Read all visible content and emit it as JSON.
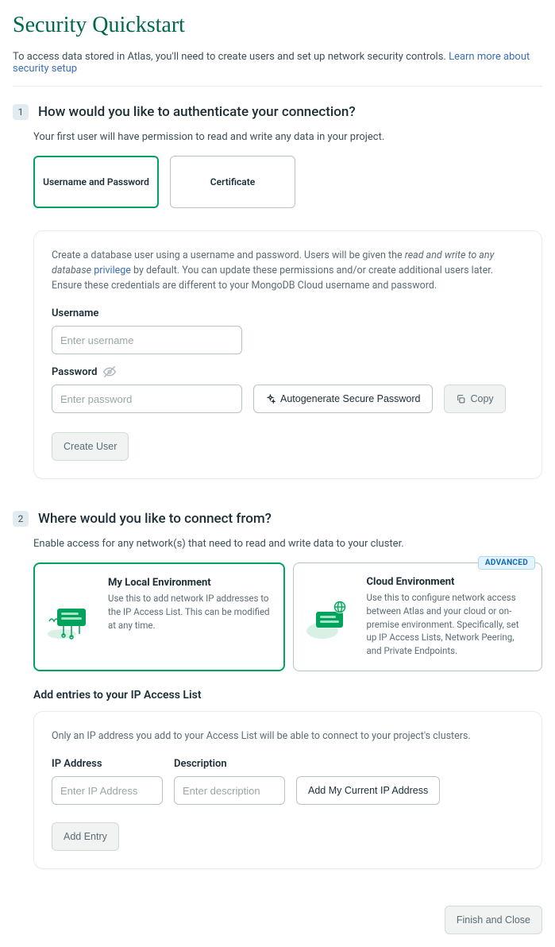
{
  "title": "Security Quickstart",
  "intro": {
    "text": "To access data stored in Atlas, you'll need to create users and set up network security controls. ",
    "link": "Learn more about security setup"
  },
  "section1": {
    "step": "1",
    "title": "How would you like to authenticate your connection?",
    "sub": "Your first user will have permission to read and write any data in your project.",
    "options": {
      "userpass": "Username and Password",
      "cert": "Certificate"
    },
    "card": {
      "text_pre": "Create a database user using a username and password. Users will be given the ",
      "text_italic": "read and write to any database",
      "priv_link": "privilege",
      "text_post": " by default. You can update these permissions and/or create additional users later. Ensure these credentials are different to your MongoDB Cloud username and password.",
      "username_label": "Username",
      "username_ph": "Enter username",
      "password_label": "Password",
      "password_ph": "Enter password",
      "autogen": "Autogenerate Secure Password",
      "copy": "Copy",
      "create": "Create User"
    }
  },
  "section2": {
    "step": "2",
    "title": "Where would you like to connect from?",
    "sub": "Enable access for any network(s) that need to read and write data to your cluster.",
    "local": {
      "title": "My Local Environment",
      "desc": "Use this to add network IP addresses to the IP Access List. This can be modified at any time."
    },
    "cloud": {
      "badge": "ADVANCED",
      "title": "Cloud Environment",
      "desc": "Use this to configure network access between Atlas and your cloud or on-premise environment. Specifically, set up IP Access Lists, Network Peering, and Private Endpoints."
    },
    "access_heading": "Add entries to your IP Access List",
    "card": {
      "text": "Only an IP address you add to your Access List will be able to connect to your project's clusters.",
      "ip_label": "IP Address",
      "ip_ph": "Enter IP Address",
      "desc_label": "Description",
      "desc_ph": "Enter description",
      "add_current": "Add My Current IP Address",
      "add_entry": "Add Entry"
    }
  },
  "footer": {
    "finish": "Finish and Close"
  }
}
